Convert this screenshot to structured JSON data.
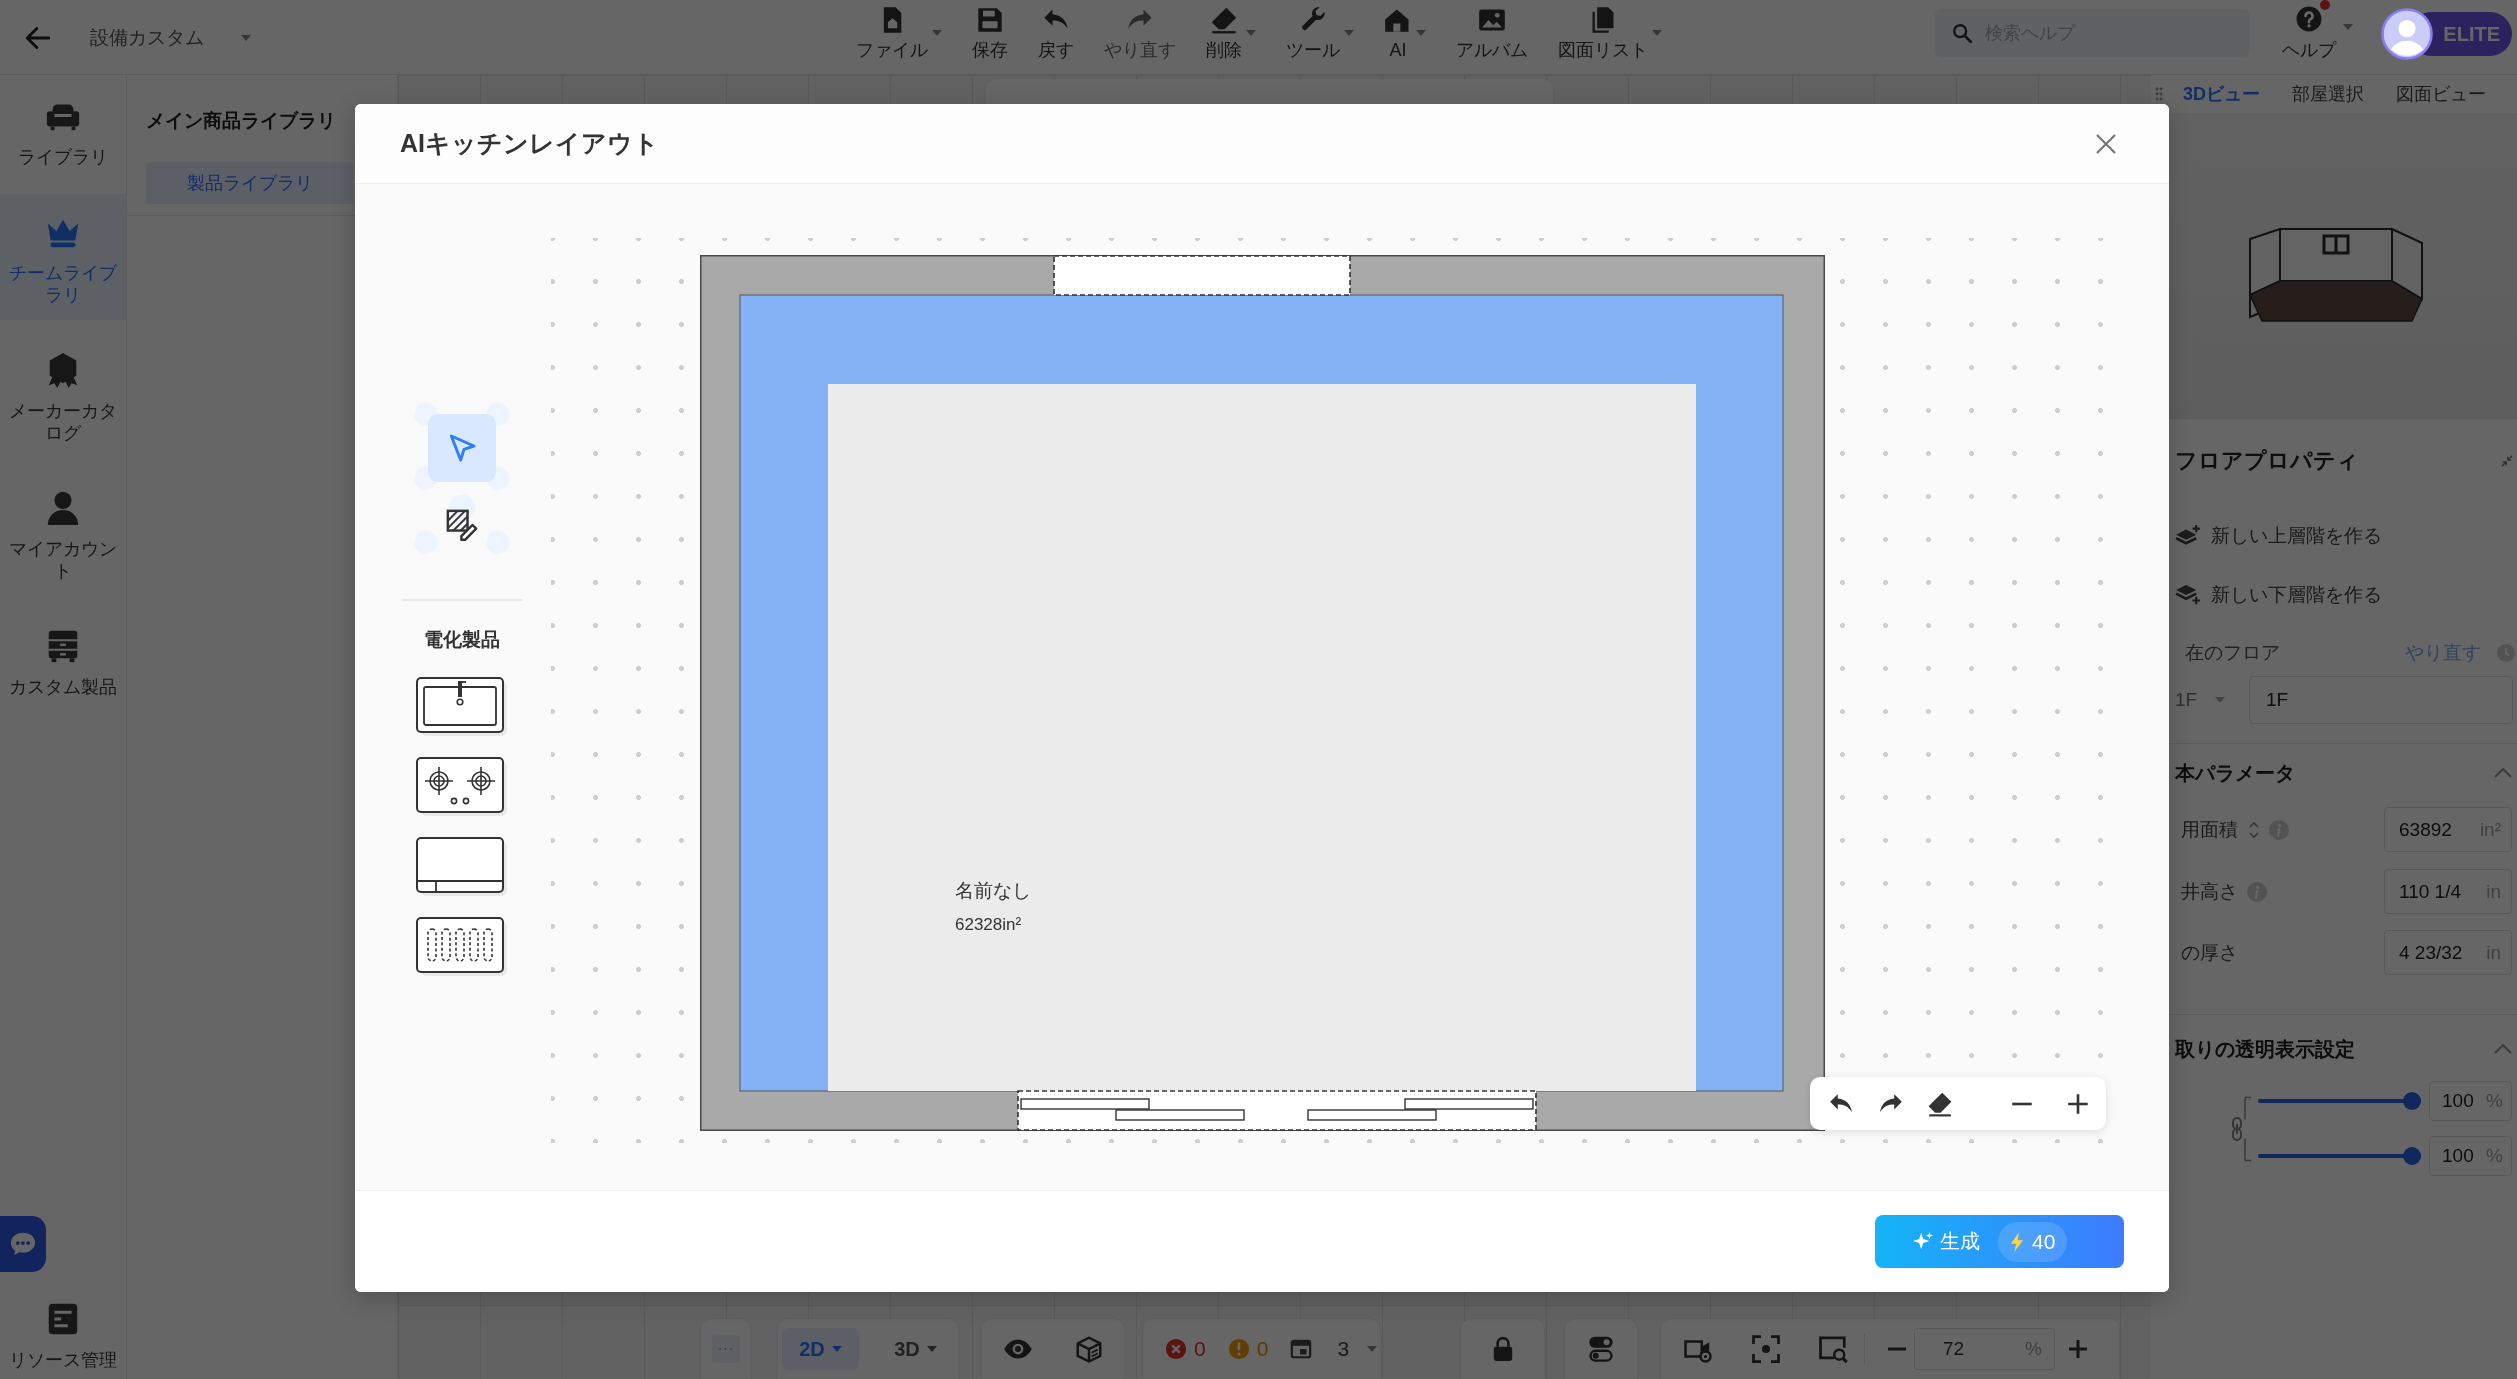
{
  "top_bar": {
    "title": "設備カスタム",
    "tools": [
      {
        "label": "ファイル",
        "dropdown": true,
        "disabled": false
      },
      {
        "label": "保存",
        "dropdown": false,
        "disabled": false
      },
      {
        "label": "戻す",
        "dropdown": false,
        "disabled": false
      },
      {
        "label": "やり直す",
        "dropdown": false,
        "disabled": true
      },
      {
        "label": "削除",
        "dropdown": true,
        "disabled": false
      },
      {
        "label": "ツール",
        "dropdown": true,
        "disabled": false
      },
      {
        "label": "AI",
        "dropdown": true,
        "disabled": false
      },
      {
        "label": "アルバム",
        "dropdown": false,
        "disabled": false
      },
      {
        "label": "図面リスト",
        "dropdown": true,
        "disabled": false
      }
    ],
    "search": {
      "placeholder": "検索ヘルプ"
    },
    "help": {
      "label": "ヘルプ",
      "notification": true
    },
    "account": {
      "badge": "ELITE"
    }
  },
  "sidebar": {
    "items": [
      {
        "label": "ライブラリ",
        "selected": false
      },
      {
        "label": "チームライブラリ",
        "selected": true
      },
      {
        "label": "メーカーカタログ",
        "selected": false
      },
      {
        "label": "マイアカウント",
        "selected": false
      },
      {
        "label": "カスタム製品",
        "selected": false
      }
    ],
    "bottom_item": {
      "label": "リソース管理"
    }
  },
  "library_panel": {
    "title": "メイン商品ライブラリ",
    "tabs": [
      {
        "label": "製品ライブラリ",
        "selected": true
      }
    ]
  },
  "view_tabs": [
    {
      "label": "3Dビュー",
      "selected": true
    },
    {
      "label": "部屋選択",
      "selected": false
    },
    {
      "label": "図面ビュー",
      "selected": false
    }
  ],
  "floor_properties": {
    "title": "フロアプロパティ",
    "actions": [
      {
        "label": "新しい上層階を作る"
      },
      {
        "label": "新しい下層階を作る"
      }
    ],
    "current_floor": {
      "label": "在のフロア",
      "reset": "やり直す",
      "floor_select": {
        "value": "1F",
        "disabled": true
      },
      "floor_name": {
        "value": "1F"
      }
    }
  },
  "basic_parameters": {
    "title": "本パラメータ",
    "expanded": true,
    "rows": [
      {
        "label": "用面積",
        "sortable": true,
        "info": true,
        "value": "63892",
        "unit": "in²"
      },
      {
        "label": "井高さ",
        "sortable": false,
        "info": true,
        "value": "110 1/4",
        "unit": "in"
      },
      {
        "label": "の厚さ",
        "sortable": false,
        "info": false,
        "value": "4 23/32",
        "unit": "in"
      }
    ]
  },
  "transparency": {
    "title": "取りの透明表示設定",
    "expanded": true,
    "sliders": [
      {
        "level": 1,
        "value": "100",
        "unit": "%"
      },
      {
        "level": 1,
        "value": "100",
        "unit": "%"
      }
    ]
  },
  "bottom_toolbar": {
    "more": "···",
    "view_modes": [
      {
        "label": "2D",
        "selected": true
      },
      {
        "label": "3D",
        "selected": false
      }
    ],
    "counts": [
      {
        "kind": "error",
        "value": "0"
      },
      {
        "kind": "warning",
        "value": "0"
      },
      {
        "kind": "layer",
        "value": "3"
      }
    ],
    "zoom": {
      "value": "72",
      "unit": "%"
    }
  },
  "dialog": {
    "title": "AIキッチンレイアウト",
    "tools": [
      {
        "selected": true
      },
      {
        "selected": false
      }
    ],
    "category": "電化製品",
    "appliances": [
      {
        "kind": "sink"
      },
      {
        "kind": "hob"
      },
      {
        "kind": "counter"
      },
      {
        "kind": "heater"
      }
    ],
    "room": {
      "name": "名前なし",
      "area": "62328in²"
    },
    "generate": {
      "label": "生成",
      "credits": "40"
    }
  }
}
